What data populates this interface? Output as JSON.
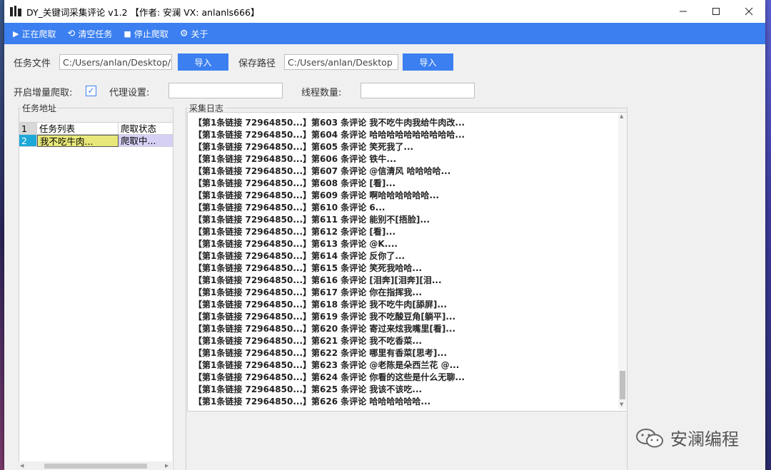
{
  "window": {
    "title": "DY_关键词采集评论 v1.2 【作者: 安澜  VX: anlanls666】"
  },
  "toolbar": {
    "items": [
      {
        "icon": "play-icon",
        "label": "正在爬取"
      },
      {
        "icon": "refresh-icon",
        "label": "清空任务"
      },
      {
        "icon": "stop-icon",
        "label": "停止爬取"
      },
      {
        "icon": "gear-icon",
        "label": "关于"
      }
    ]
  },
  "form": {
    "task_file_label": "任务文件",
    "task_file_value": "C:/Users/anlan/Desktop/t",
    "import_label": "导入",
    "save_path_label": "保存路径",
    "save_path_value": "C:/Users/anlan/Desktop",
    "import2_label": "导入",
    "incremental_label": "开启增量爬取:",
    "incremental_checked": true,
    "proxy_label": "代理设置:",
    "proxy_value": "",
    "threads_label": "线程数量:",
    "threads_value": ""
  },
  "task_panel": {
    "title": "任务地址",
    "columns": [
      "任务列表",
      "爬取状态"
    ],
    "rows": [
      {
        "index": "2",
        "task": "我不吃牛肉...",
        "status": "爬取中..."
      }
    ],
    "header_index": "1"
  },
  "log_panel": {
    "title": "采集日志",
    "lines": [
      "【第1条链接 72964850...】第603 条评论  我不吃牛肉我给牛肉改...",
      "【第1条链接 72964850...】第604 条评论  哈哈哈哈哈哈哈哈哈哈...",
      "【第1条链接 72964850...】第605 条评论  笑死我了...",
      "【第1条链接 72964850...】第606 条评论  铁牛...",
      "【第1条链接 72964850...】第607 条评论  @信清风 哈哈哈哈...",
      "【第1条链接 72964850...】第608 条评论  [看]...",
      "【第1条链接 72964850...】第609 条评论  啊哈哈哈哈哈哈...",
      "【第1条链接 72964850...】第610 条评论  6...",
      "【第1条链接 72964850...】第611 条评论  能别不[捂脸]...",
      "【第1条链接 72964850...】第612 条评论  [看]...",
      "【第1条链接 72964850...】第613 条评论  @K....",
      "【第1条链接 72964850...】第614 条评论  反你了...",
      "【第1条链接 72964850...】第615 条评论  笑死我哈哈...",
      "【第1条链接 72964850...】第616 条评论  [泪奔][泪奔][泪...",
      "【第1条链接 72964850...】第617 条评论  你在指挥我...",
      "【第1条链接 72964850...】第618 条评论  我不吃牛肉[舔屏]...",
      "【第1条链接 72964850...】第619 条评论  我不吃酸豆角[躺平]...",
      "【第1条链接 72964850...】第620 条评论  寄过来炫我嘴里[看]...",
      "【第1条链接 72964850...】第621 条评论  我不吃香菜...",
      "【第1条链接 72964850...】第622 条评论  哪里有香菜[思考]...",
      "【第1条链接 72964850...】第623 条评论  @老陈是朵西兰花 @...",
      "【第1条链接 72964850...】第624 条评论  你看的这些是什么无聊...",
      "【第1条链接 72964850...】第625 条评论  我该不该吃...",
      "【第1条链接 72964850...】第626 条评论  哈哈哈哈哈哈..."
    ]
  },
  "watermark": {
    "text": "安澜编程"
  },
  "colors": {
    "accent": "#3b7ff0",
    "selected_cell": "#e8e87a",
    "status_cell": "#d6d0f5",
    "index_cell": "#1ea8d8"
  }
}
